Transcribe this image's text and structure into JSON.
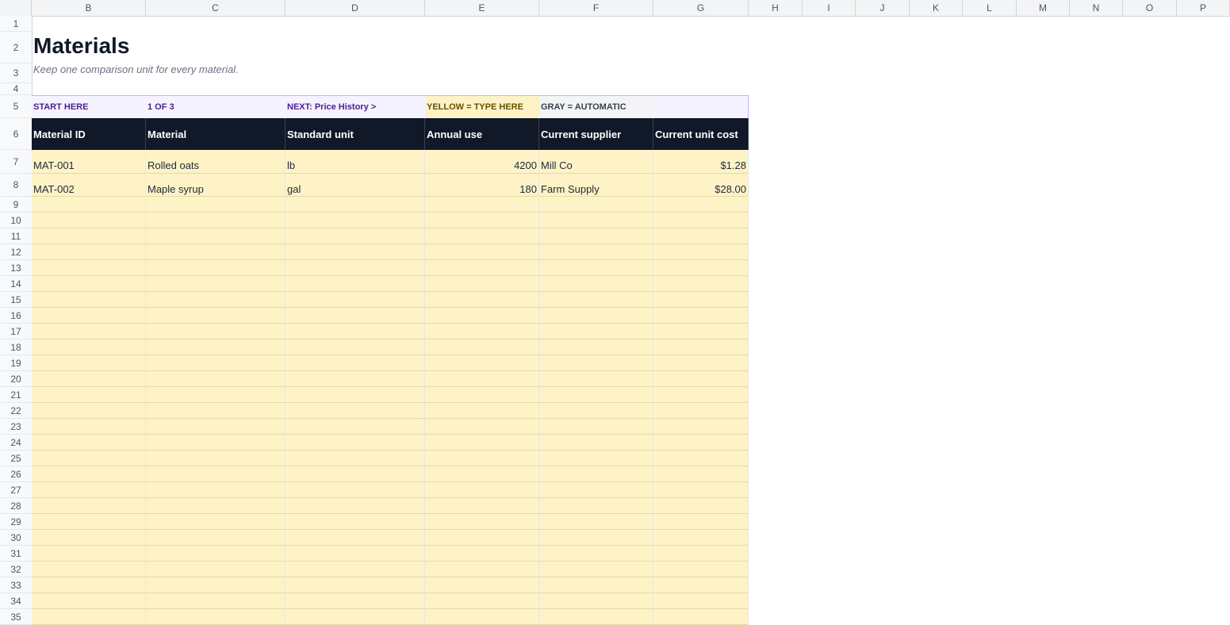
{
  "sheet": {
    "title": "Materials",
    "subtitle": "Keep one comparison unit for every material."
  },
  "columns": [
    "B",
    "C",
    "D",
    "E",
    "F",
    "G",
    "H",
    "I",
    "J",
    "K",
    "L",
    "M",
    "N",
    "O",
    "P"
  ],
  "rows": [
    "1",
    "2",
    "3",
    "4",
    "5",
    "6",
    "7",
    "8",
    "9",
    "10",
    "11",
    "12",
    "13",
    "14",
    "15",
    "16",
    "17",
    "18",
    "19",
    "20",
    "21",
    "22",
    "23",
    "24",
    "25",
    "26",
    "27",
    "28",
    "29",
    "30",
    "31",
    "32",
    "33",
    "34",
    "35"
  ],
  "nav": {
    "start": "START HERE",
    "step": "1 OF 3",
    "next": "NEXT: Price History  >",
    "yellow_legend": "YELLOW = TYPE HERE",
    "gray_legend": "GRAY = AUTOMATIC"
  },
  "table": {
    "headers": [
      "Material ID",
      "Material",
      "Standard unit",
      "Annual use",
      "Current supplier",
      "Current unit cost"
    ],
    "rows": [
      [
        "MAT-001",
        "Rolled oats",
        "lb",
        "4200",
        "Mill Co",
        "$1.28"
      ],
      [
        "MAT-002",
        "Maple syrup",
        "gal",
        "180",
        "Farm Supply",
        "$28.00"
      ]
    ]
  },
  "colors": {
    "header_bg": "#111827",
    "input_yellow": "#fef3c7",
    "nav_purple": "#f5f3ff",
    "accent_purple": "#4c1d95"
  }
}
